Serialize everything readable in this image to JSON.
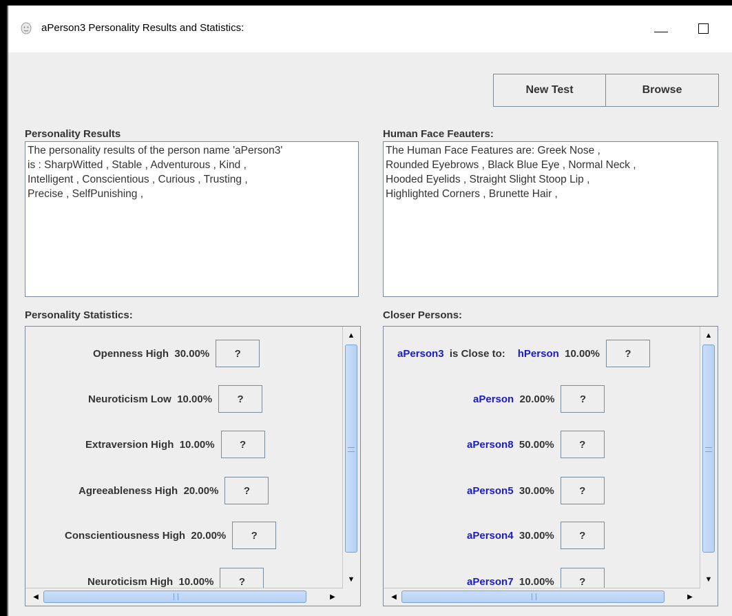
{
  "window": {
    "title": "aPerson3 Personality Results and Statistics:"
  },
  "toolbar": {
    "new_test_label": "New Test",
    "browse_label": "Browse"
  },
  "personality_results": {
    "label": "Personality Results",
    "lines": [
      "The personality results of the person name 'aPerson3'",
      "is : SharpWitted , Stable , Adventurous , Kind ,",
      "Intelligent , Conscientious , Curious , Trusting ,",
      "Precise , SelfPunishing ,"
    ]
  },
  "face_features": {
    "label": "Human Face Feauters:",
    "lines": [
      "The Human Face Features  are:  Greek Nose ,",
      "Rounded Eyebrows ,  Black Blue Eye ,  Normal Neck ,",
      "Hooded Eyelids ,  Straight Slight Stoop Lip ,",
      "Highlighted Corners ,  Brunette Hair ,"
    ]
  },
  "statistics": {
    "label": "Personality Statistics:",
    "question_label": "?",
    "rows": [
      {
        "trait": "Openness High",
        "value": "30.00%"
      },
      {
        "trait": "Neuroticism Low",
        "value": "10.00%"
      },
      {
        "trait": "Extraversion High",
        "value": "10.00%"
      },
      {
        "trait": "Agreeableness High",
        "value": "20.00%"
      },
      {
        "trait": "Conscientiousness High",
        "value": "20.00%"
      },
      {
        "trait": "Neuroticism High",
        "value": "10.00%"
      }
    ]
  },
  "closer_persons": {
    "label": "Closer Persons:",
    "subject": "aPerson3",
    "connector": "is Close to:",
    "question_label": "?",
    "rows": [
      {
        "name": "hPerson",
        "value": "10.00%"
      },
      {
        "name": "aPerson",
        "value": "20.00%"
      },
      {
        "name": "aPerson8",
        "value": "50.00%"
      },
      {
        "name": "aPerson5",
        "value": "30.00%"
      },
      {
        "name": "aPerson4",
        "value": "30.00%"
      },
      {
        "name": "aPerson7",
        "value": "10.00%"
      }
    ]
  }
}
